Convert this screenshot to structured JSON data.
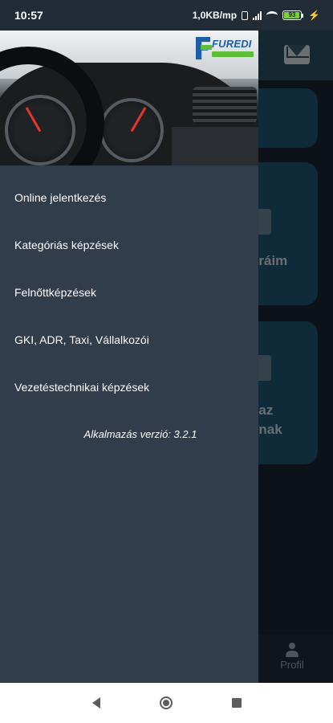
{
  "status_bar": {
    "time": "10:57",
    "network_speed": "1,0KB/mp",
    "battery_level": "93",
    "battery_fraction": 0.93
  },
  "background": {
    "card_2_text": "óráim",
    "card_3_text_line1": "t az",
    "card_3_text_line2": "nnak",
    "bottom_nav_profile": "Profil"
  },
  "drawer": {
    "logo_text": "FUREDI",
    "menu": [
      {
        "label": "Online jelentkezés"
      },
      {
        "label": "Kategóriás képzések"
      },
      {
        "label": "Felnőttképzések"
      },
      {
        "label": "GKI, ADR, Taxi, Vállalkozói"
      },
      {
        "label": "Vezetéstechnikai képzések"
      }
    ],
    "version": "Alkalmazás verzió: 3.2.1"
  },
  "colors": {
    "drawer_bg": "#313d4a",
    "header_bg": "#2a4f62",
    "card_bg": "#1f5470",
    "accent_red": "#e63528",
    "logo_blue": "#1c5fa8",
    "logo_green": "#5bbf3a"
  },
  "icons": [
    "mail-icon",
    "profile-icon",
    "back-icon",
    "home-icon",
    "recents-icon",
    "bluetooth-icon",
    "signal-icon",
    "wifi-icon",
    "battery-icon",
    "charging-icon"
  ]
}
